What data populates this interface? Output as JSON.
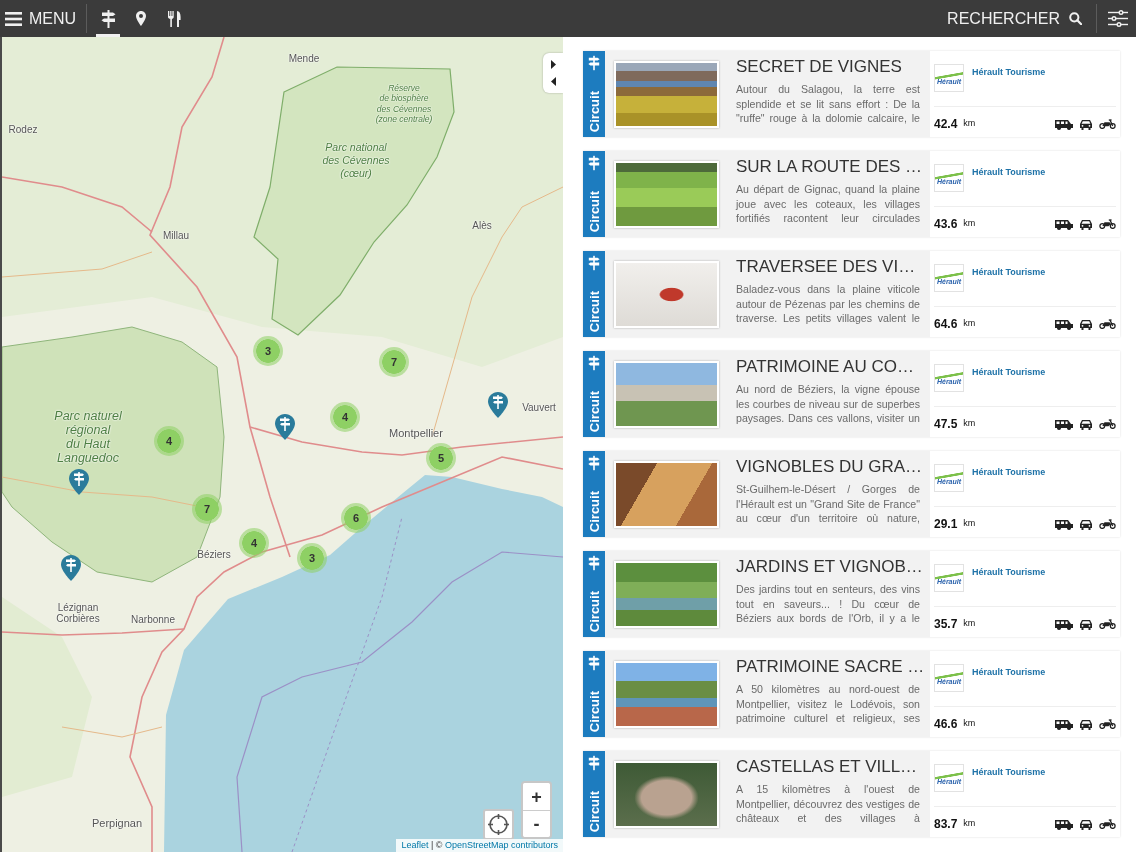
{
  "top_bar": {
    "menu": {
      "label": "MENU"
    },
    "tabs": [
      {
        "kind": "signpost",
        "selected": true
      },
      {
        "kind": "pin",
        "selected": false
      },
      {
        "kind": "cutlery",
        "selected": false
      }
    ],
    "search": {
      "label": "RECHERCHER"
    }
  },
  "map": {
    "labels": [
      {
        "kind": "city",
        "lines": [
          "Mende"
        ]
      },
      {
        "kind": "city",
        "lines": [
          "Rodez"
        ]
      },
      {
        "kind": "park",
        "lines": [
          "Réserve",
          "de biosphère",
          "des Cévennes",
          "(zone centrale)"
        ]
      },
      {
        "kind": "park",
        "lines": [
          "Parc national",
          "des Cévennes",
          "(cœur)"
        ]
      },
      {
        "kind": "city",
        "lines": [
          "Millau"
        ]
      },
      {
        "kind": "city",
        "lines": [
          "Alès"
        ]
      },
      {
        "kind": "city",
        "lines": [
          "Vauvert"
        ]
      },
      {
        "kind": "city",
        "lines": [
          "Montpellier"
        ]
      },
      {
        "kind": "park",
        "lines": [
          "Parc naturel",
          "régional",
          "du Haut",
          "Languedoc"
        ]
      },
      {
        "kind": "city",
        "lines": [
          "Béziers"
        ]
      },
      {
        "kind": "city",
        "lines": [
          "Lézignan",
          "Corbières"
        ]
      },
      {
        "kind": "city",
        "lines": [
          "Narbonne"
        ]
      },
      {
        "kind": "city",
        "lines": [
          "Perpignan"
        ]
      }
    ],
    "clusters": [
      {
        "count": "3"
      },
      {
        "count": "7"
      },
      {
        "count": "4"
      },
      {
        "count": "4"
      },
      {
        "count": "5"
      },
      {
        "count": "7"
      },
      {
        "count": "6"
      },
      {
        "count": "4"
      },
      {
        "count": "3"
      }
    ],
    "pins": [
      {
        "kind": "signpost"
      },
      {
        "kind": "signpost"
      },
      {
        "kind": "signpost"
      },
      {
        "kind": "signpost"
      }
    ],
    "zoom": {
      "zoom_in": "+",
      "zoom_out": "-"
    },
    "attribution": [
      {
        "kind": "link",
        "text": "Leaflet"
      },
      {
        "kind": "text",
        "text": "| ©"
      },
      {
        "kind": "link",
        "text": "OpenStreetMap contributors"
      }
    ]
  },
  "results": [
    {
      "category": "Circuit",
      "title": "SECRET DE VIGNES",
      "description": "Autour du Salagou, la terre est\nsplendide et se lit sans effort : De la\n\"ruffe\" rouge à la dolomie calcaire, le",
      "logo": "Hérault",
      "publisher": "Hérault Tourisme",
      "distance": "42.4",
      "unit": "km"
    },
    {
      "category": "Circuit",
      "title": "SUR LA ROUTE DES …",
      "description": "Au départ de Gignac, quand la plaine\njoue avec les coteaux, les villages\nfortifiés racontent leur circulades",
      "logo": "Hérault",
      "publisher": "Hérault Tourisme",
      "distance": "43.6",
      "unit": "km"
    },
    {
      "category": "Circuit",
      "title": "TRAVERSEE DES VI…",
      "description": "Baladez-vous dans la plaine viticole\nautour de Pézenas par les chemins de\ntraverse. Les petits villages valent le",
      "logo": "Hérault",
      "publisher": "Hérault Tourisme",
      "distance": "64.6",
      "unit": "km"
    },
    {
      "category": "Circuit",
      "title": "PATRIMOINE AU CO…",
      "description": "Au nord de Béziers, la vigne épouse\nles courbes de niveau sur de superbes\npaysages. Dans ces vallons, visiter un",
      "logo": "Hérault",
      "publisher": "Hérault Tourisme",
      "distance": "47.5",
      "unit": "km"
    },
    {
      "category": "Circuit",
      "title": "VIGNOBLES DU GRA…",
      "description": "St-Guilhem-le-Désert / Gorges de\nl'Hérault est un \"Grand Site de France\"\nau cœur d'un territoire où nature,",
      "logo": "Hérault",
      "publisher": "Hérault Tourisme",
      "distance": "29.1",
      "unit": "km"
    },
    {
      "category": "Circuit",
      "title": "JARDINS ET VIGNOB…",
      "description": "Des jardins tout en senteurs, des vins\ntout en saveurs... ! Du cœur de\nBéziers aux bords de l'Orb, il y a le",
      "logo": "Hérault",
      "publisher": "Hérault Tourisme",
      "distance": "35.7",
      "unit": "km"
    },
    {
      "category": "Circuit",
      "title": "PATRIMOINE SACRE …",
      "description": "A 50 kilomètres au nord-ouest de\nMontpellier, visitez le Lodévois, son\npatrimoine culturel et religieux, ses",
      "logo": "Hérault",
      "publisher": "Hérault Tourisme",
      "distance": "46.6",
      "unit": "km"
    },
    {
      "category": "Circuit",
      "title": "CASTELLAS ET VILL…",
      "description": "A 15 kilomètres à l'ouest de\nMontpellier, découvrez des vestiges de\nchâteaux et des villages à",
      "logo": "Hérault",
      "publisher": "Hérault Tourisme",
      "distance": "83.7",
      "unit": "km"
    }
  ]
}
